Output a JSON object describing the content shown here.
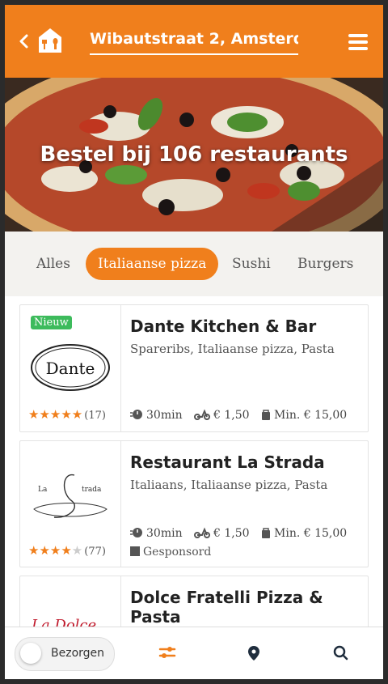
{
  "header": {
    "address": "Wibautstraat 2, Amsterd...",
    "accent": "#f07f1c"
  },
  "hero": {
    "title": "Bestel bij 106 restaurants"
  },
  "tabs": [
    {
      "label": "Alles",
      "active": false
    },
    {
      "label": "Italiaanse pizza",
      "active": true
    },
    {
      "label": "Sushi",
      "active": false
    },
    {
      "label": "Burgers",
      "active": false
    }
  ],
  "restaurants": [
    {
      "badge": "Nieuw",
      "logo_text": "Dante",
      "name": "Dante Kitchen & Bar",
      "cuisines": "Spareribs, Italiaanse pizza, Pasta",
      "delivery_time": "30min",
      "delivery_cost": "€ 1,50",
      "min_order": "Min. € 15,00",
      "rating": 5,
      "rating_count": "(17)"
    },
    {
      "logo_text": "La Strada",
      "name": "Restaurant La Strada",
      "cuisines": "Italiaans, Italiaanse pizza, Pasta",
      "delivery_time": "30min",
      "delivery_cost": "€ 1,50",
      "min_order": "Min. € 15,00",
      "rating": 4,
      "rating_count": "(77)",
      "sponsored": "Gesponsord"
    },
    {
      "logo_text": "La Dolce",
      "name": "Dolce Fratelli Pizza & Pasta"
    }
  ],
  "bottom_bar": {
    "toggle_label": "Bezorgen",
    "icons": [
      "filter-icon",
      "location-pin-icon",
      "search-icon"
    ]
  }
}
